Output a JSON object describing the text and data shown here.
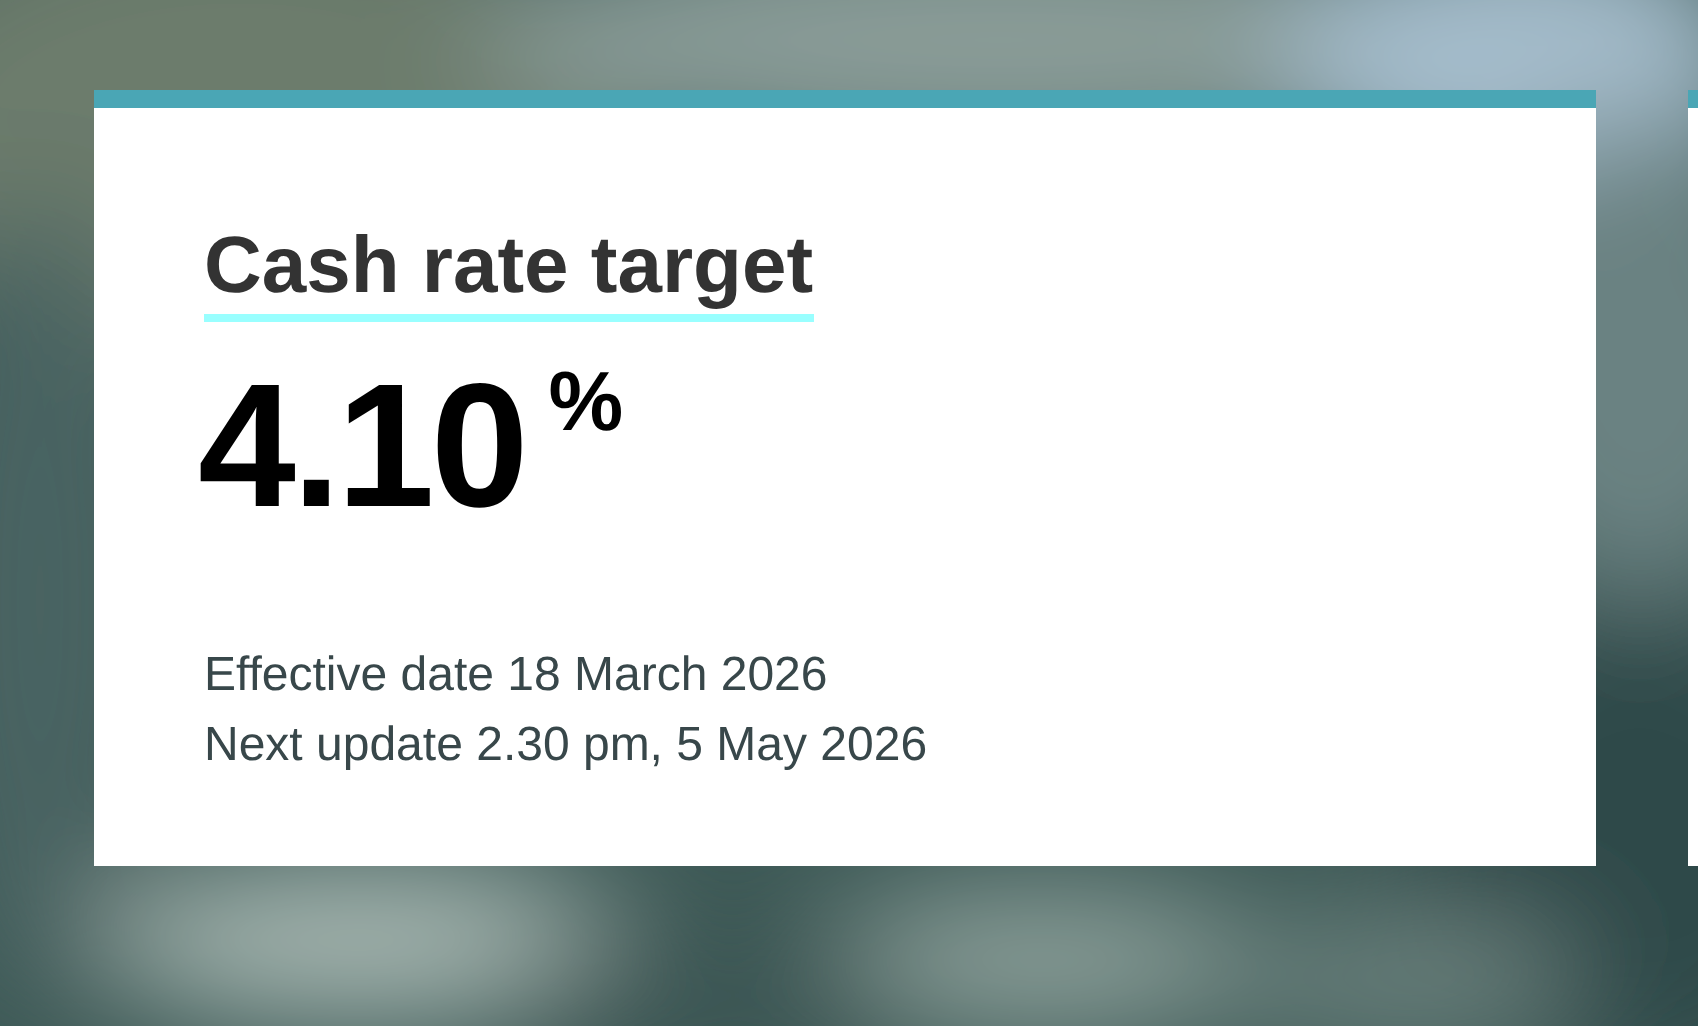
{
  "card": {
    "title": "Cash rate target",
    "value": "4.10",
    "unit": "%",
    "details": [
      "Effective date 18 March 2026",
      "Next update 2.30 pm, 5 May 2026"
    ]
  }
}
